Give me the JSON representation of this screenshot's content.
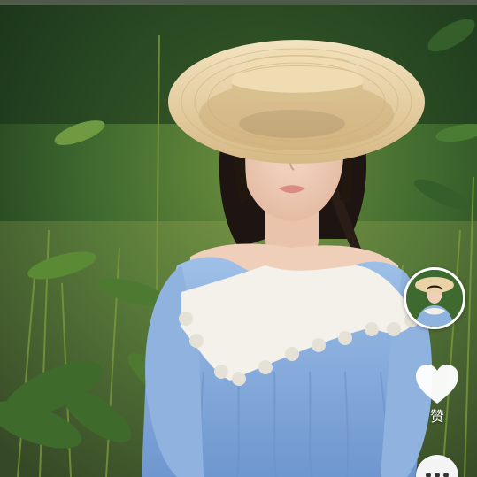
{
  "actions": {
    "like_label": "赞"
  },
  "icons": {
    "like": "heart-icon",
    "more": "more-dots-icon",
    "avatar": "author-avatar"
  },
  "colors": {
    "dress": "#8fb3df",
    "hat": "#e8d2a6",
    "background": "#2f5a2c",
    "like_heart": "#ffffff"
  }
}
